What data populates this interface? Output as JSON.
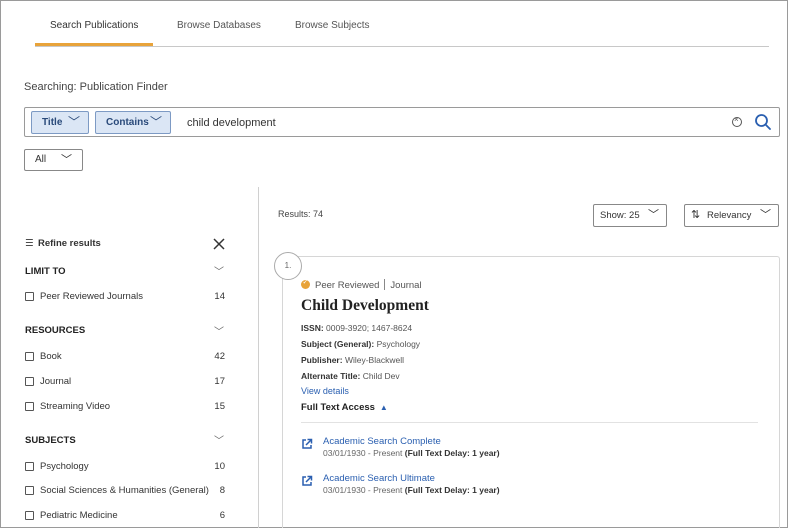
{
  "tabs": [
    {
      "label": "Search Publications",
      "active": true
    },
    {
      "label": "Browse Databases",
      "active": false
    },
    {
      "label": "Browse Subjects",
      "active": false
    }
  ],
  "searching_label": "Searching: Publication Finder",
  "search": {
    "field_select": "Title",
    "operator_select": "Contains",
    "query": "child development"
  },
  "filter_select": "All",
  "refine": {
    "title": "Refine results",
    "groups": [
      {
        "heading": "LIMIT TO",
        "items": [
          {
            "label": "Peer Reviewed Journals",
            "count": "14"
          }
        ]
      },
      {
        "heading": "RESOURCES",
        "items": [
          {
            "label": "Book",
            "count": "42"
          },
          {
            "label": "Journal",
            "count": "17"
          },
          {
            "label": "Streaming Video",
            "count": "15"
          }
        ]
      },
      {
        "heading": "SUBJECTS",
        "items": [
          {
            "label": "Psychology",
            "count": "10"
          },
          {
            "label": "Social Sciences & Humanities (General)",
            "count": "8"
          },
          {
            "label": "Pediatric Medicine",
            "count": "6"
          }
        ]
      }
    ]
  },
  "results": {
    "count_label": "Results: 74",
    "show_label": "Show: 25",
    "sort_label": "Relevancy"
  },
  "result": {
    "number": "1.",
    "peer_reviewed": "Peer Reviewed",
    "type": "Journal",
    "title": "Child Development",
    "issn_label": "ISSN:",
    "issn": "0009-3920; 1467-8624",
    "subject_label": "Subject (General):",
    "subject": "Psychology",
    "publisher_label": "Publisher:",
    "publisher": "Wiley-Blackwell",
    "alt_title_label": "Alternate Title:",
    "alt_title": "Child Dev",
    "view_details": "View details",
    "full_text_access": "Full Text Access",
    "databases": [
      {
        "name": "Academic Search Complete",
        "coverage": "03/01/1930 - Present",
        "delay": "(Full Text Delay: 1 year)"
      },
      {
        "name": "Academic Search Ultimate",
        "coverage": "03/01/1930 - Present",
        "delay": "(Full Text Delay: 1 year)"
      }
    ]
  },
  "colors": {
    "accent": "#e8a33a",
    "link": "#2a5fb0",
    "select_bg": "#dbe6f5"
  }
}
